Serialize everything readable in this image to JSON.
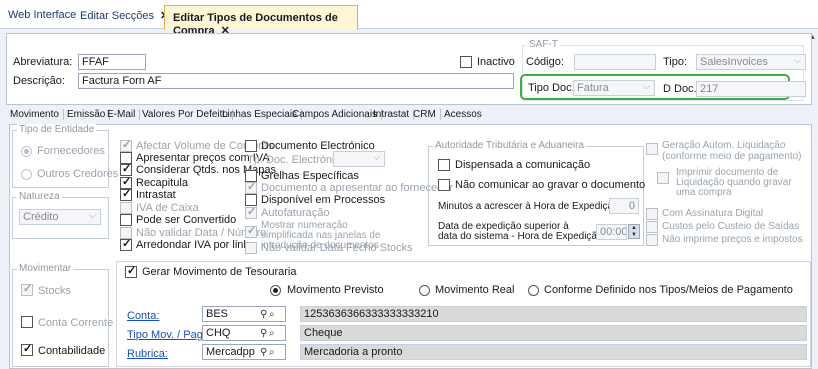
{
  "tabs": [
    {
      "label": "Web Interface",
      "closable": false
    },
    {
      "label": "Editar Secções",
      "closable": true
    },
    {
      "label": "Editar Tipos de Documentos de Compra",
      "closable": true
    }
  ],
  "header": {
    "abreviatura_label": "Abreviatura:",
    "abreviatura_value": "FFAF",
    "descricao_label": "Descrição:",
    "descricao_value": "Factura Forn AF",
    "inactivo_label": "Inactivo",
    "inactivo_checked": false,
    "saft_legend": "SAF-T",
    "codigo_label": "Código:",
    "codigo_value": "",
    "tipo_label": "Tipo:",
    "tipo_value": "SalesInvoices",
    "tipo_doc_label": "Tipo Doc. :",
    "tipo_doc_value": "Fatura",
    "id_doc_label": "D Doc. :",
    "id_doc_value": "217",
    "highlight_color": "#3fae3f"
  },
  "subtabs": [
    "Movimento",
    "Emissão",
    "E-Mail",
    "Valores Por Defeito",
    "Linhas Especiais",
    "Campos Adicionais",
    "Intrastat",
    "CRM",
    "Acessos"
  ],
  "tipo_entidade": {
    "legend": "Tipo de Entidade",
    "options": [
      {
        "label": "Fornecedores",
        "selected": true
      },
      {
        "label": "Outros Credores",
        "selected": false
      }
    ]
  },
  "natureza": {
    "legend": "Natureza",
    "value": "Crédito"
  },
  "movimentar": {
    "legend": "Movimentar",
    "items": [
      {
        "label": "Stocks",
        "checked": true,
        "disabled": true
      },
      {
        "label": "Conta Corrente",
        "checked": false,
        "disabled": false
      },
      {
        "label": "Contabilidade",
        "checked": true,
        "disabled": false
      }
    ]
  },
  "col1": [
    {
      "label": "Afectar Volume de Compras",
      "checked": true,
      "disabled": true
    },
    {
      "label": "Apresentar preços com IVA",
      "checked": false,
      "disabled": false
    },
    {
      "label": "Considerar Qtds. nos Mapas",
      "checked": true,
      "disabled": false
    },
    {
      "label": "Recapitula",
      "checked": true,
      "disabled": false
    },
    {
      "label": "Intrastat",
      "checked": true,
      "disabled": false
    },
    {
      "label": "IVA de Caixa",
      "checked": false,
      "disabled": true
    },
    {
      "label": "Pode ser Convertido",
      "checked": false,
      "disabled": false
    },
    {
      "label": "Não validar Data / Número",
      "checked": false,
      "disabled": true
    },
    {
      "label": "Arredondar IVA por linha",
      "checked": true,
      "disabled": false
    }
  ],
  "col2": {
    "doc_electronico": "Documento Electrónico",
    "tp_doc_electronico": "Tp. Doc. Electrónico:",
    "grelhas": "Grelhas Específicas",
    "doc_apresentar": "Documento a apresentar ao fornecedor",
    "disponivel": "Disponível em Processos",
    "autofaturacao": "Autofaturação",
    "mostrar_numeracao": "Mostrar numeração simplificada nas janelas de introdução de documentos",
    "nao_validar_fecho": "Não validar Data Fecho Stocks"
  },
  "autoridade": {
    "legend": "Autoridade Tributária e Aduaneira",
    "dispensada": "Dispensada a comunicação",
    "nao_comunicar": "Não comunicar ao gravar o documento",
    "minutos_label": "Minutos a acrescer à Hora de Expedição:",
    "minutos_value": "0",
    "data_exp_label1": "Data de expedição superior à",
    "data_exp_label2": "data do sistema - Hora de Expedição:",
    "hora_value": "00:00"
  },
  "col4": {
    "geracao": "Geração Autom. Liquidação (conforme meio de pagamento)",
    "imprimir": "Imprimir documento de Liquidação quando gravar uma compra",
    "assinatura": "Com Assinatura Digital",
    "custos": "Custos pelo Custeio de Saídas",
    "nao_imprime": "Não imprime preços e impostos"
  },
  "tesouraria": {
    "label": "Gerar Movimento de Tesouraria",
    "checked": true,
    "options": [
      "Movimento Previsto",
      "Movimento Real",
      "Conforme Definido nos Tipos/Meios de Pagamento"
    ],
    "selected": 0,
    "rows": [
      {
        "label": "Conta:",
        "code": "BES",
        "desc": "1253636366333333333210"
      },
      {
        "label": "Tipo Mov. / Pag.:",
        "code": "CHQ",
        "desc": "Cheque"
      },
      {
        "label": "Rubrica:",
        "code": "Mercadpp",
        "desc": "Mercadoria a pronto"
      }
    ]
  }
}
